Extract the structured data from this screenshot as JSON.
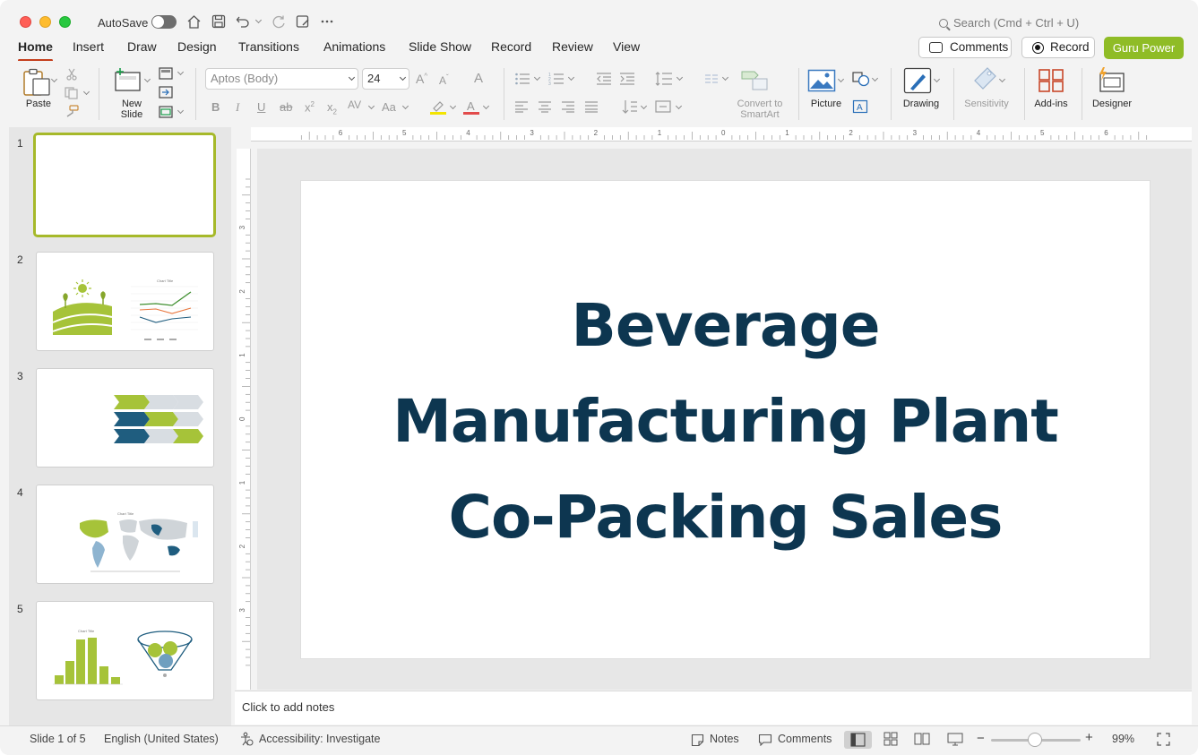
{
  "titlebar": {
    "autosave_label": "AutoSave",
    "search_placeholder": "Search (Cmd + Ctrl + U)"
  },
  "tabs": [
    "Home",
    "Insert",
    "Draw",
    "Design",
    "Transitions",
    "Animations",
    "Slide Show",
    "Record",
    "Review",
    "View"
  ],
  "header_buttons": {
    "comments": "Comments",
    "record": "Record",
    "guru": "Guru Power"
  },
  "ribbon": {
    "paste": "Paste",
    "new_slide_line1": "New",
    "new_slide_line2": "Slide",
    "font_name": "Aptos (Body)",
    "font_size": "24",
    "convert_line1": "Convert to",
    "convert_line2": "SmartArt",
    "picture": "Picture",
    "drawing": "Drawing",
    "sensitivity": "Sensitivity",
    "addins": "Add-ins",
    "designer": "Designer"
  },
  "thumbnails": [
    {
      "number": "1"
    },
    {
      "number": "2",
      "chart_title": "Chart Title"
    },
    {
      "number": "3"
    },
    {
      "number": "4",
      "chart_title": "Chart Title"
    },
    {
      "number": "5",
      "chart_title": "Chart Title"
    }
  ],
  "slide": {
    "title_line1": "Beverage",
    "title_line2": "Manufacturing Plant",
    "title_line3": "Co-Packing Sales"
  },
  "notes_placeholder": "Click to add notes",
  "status": {
    "slide_info": "Slide 1 of 5",
    "language": "English (United States)",
    "accessibility": "Accessibility: Investigate",
    "notes": "Notes",
    "comments": "Comments",
    "zoom": "99%"
  },
  "ruler": {
    "top_labels": [
      "6",
      "5",
      "4",
      "3",
      "2",
      "1",
      "0",
      "1",
      "2",
      "3",
      "4",
      "5",
      "6"
    ],
    "left_labels": [
      "3",
      "2",
      "1",
      "0",
      "1",
      "2",
      "3"
    ]
  },
  "colors": {
    "accent_tab": "#c43e1c",
    "guru": "#8fbc26",
    "title": "#0d3650",
    "thumb_green": "#a6c339",
    "thumb_blue": "#1f5d7f"
  }
}
